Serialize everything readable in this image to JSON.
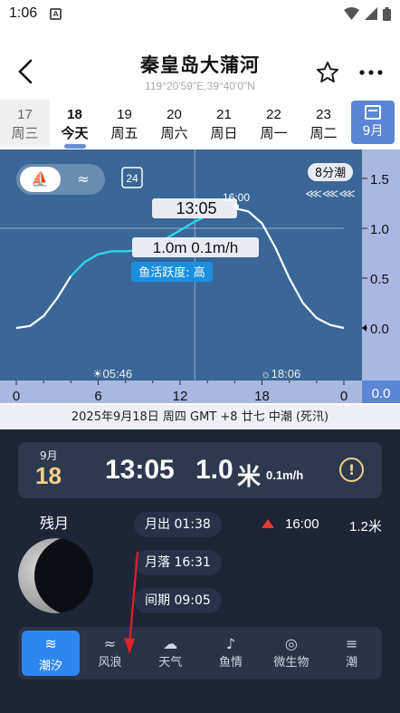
{
  "status": {
    "time": "1:06"
  },
  "header": {
    "title": "秦皇岛大蒲河",
    "coords": "119°20'59\"E,39°40'0\"N"
  },
  "dates": [
    {
      "day": "17",
      "week": "周三",
      "state": "past"
    },
    {
      "day": "18",
      "week": "今天",
      "state": "today"
    },
    {
      "day": "19",
      "week": "周五",
      "state": ""
    },
    {
      "day": "20",
      "week": "周六",
      "state": ""
    },
    {
      "day": "21",
      "week": "周日",
      "state": ""
    },
    {
      "day": "22",
      "week": "周一",
      "state": ""
    },
    {
      "day": "23",
      "week": "周二",
      "state": ""
    }
  ],
  "calendar": {
    "label": "9月"
  },
  "chart_data": {
    "type": "line",
    "x_ticks": [
      "0",
      "6",
      "12",
      "18",
      "0"
    ],
    "y_ticks": [
      "1.5",
      "1.0",
      "0.5",
      "0.0"
    ],
    "y_range": [
      0,
      1.7
    ],
    "x_range": [
      0,
      24
    ],
    "x": [
      0,
      1,
      2,
      3,
      4,
      5,
      6,
      7,
      8,
      9,
      10,
      11,
      12,
      13,
      14,
      15,
      16,
      17,
      18,
      19,
      20,
      21,
      22,
      23,
      24
    ],
    "y": [
      0.0,
      0.02,
      0.12,
      0.3,
      0.52,
      0.66,
      0.74,
      0.77,
      0.77,
      0.78,
      0.82,
      0.9,
      0.98,
      1.06,
      1.13,
      1.18,
      1.2,
      1.17,
      1.05,
      0.8,
      0.5,
      0.25,
      0.1,
      0.03,
      0.0
    ],
    "current_x": 13.08,
    "current_y": 1.0,
    "peak_label": "16:00",
    "current_time": "13:05",
    "current_value": "1.0m  0.1m/h",
    "fish_activity": "鱼活跃度: 高",
    "sunrise": "05:46",
    "sunset": "18:06",
    "tide_tag": "8分潮",
    "badge_24": "24",
    "bottom_right_value": "0.0"
  },
  "info_line": "2025年9月18日  周四  GMT +8  廿七  中潮 (死汛)",
  "card": {
    "month": "9月",
    "day": "18",
    "time": "13:05",
    "height": "1.0",
    "unit": "米",
    "speed": "0.1m/h"
  },
  "moon": {
    "label": "残月",
    "rise": "月出 01:38",
    "set": "月落 16:31",
    "interval": "间期 09:05"
  },
  "tide_extreme": {
    "time": "16:00",
    "value": "1.2米"
  },
  "tabs": [
    {
      "label": "潮汐",
      "icon": "tide-icon",
      "glyph": "≋",
      "active": true
    },
    {
      "label": "风浪",
      "icon": "wind-icon",
      "glyph": "≈",
      "active": false
    },
    {
      "label": "天气",
      "icon": "cloud-icon",
      "glyph": "☁",
      "active": false
    },
    {
      "label": "鱼情",
      "icon": "fish-icon",
      "glyph": "♪",
      "active": false
    },
    {
      "label": "微生物",
      "icon": "microbe-icon",
      "glyph": "◎",
      "active": false
    },
    {
      "label": "潮",
      "icon": "more-icon",
      "glyph": "≡",
      "active": false
    }
  ],
  "colors": {
    "accent": "#5b86d6",
    "chart_bg": "#3a6698",
    "curve_now": "#2ad6ee",
    "panel": "#1d2536",
    "tab_active": "#2c87f0",
    "gold": "#f0d189",
    "red": "#e53935"
  }
}
